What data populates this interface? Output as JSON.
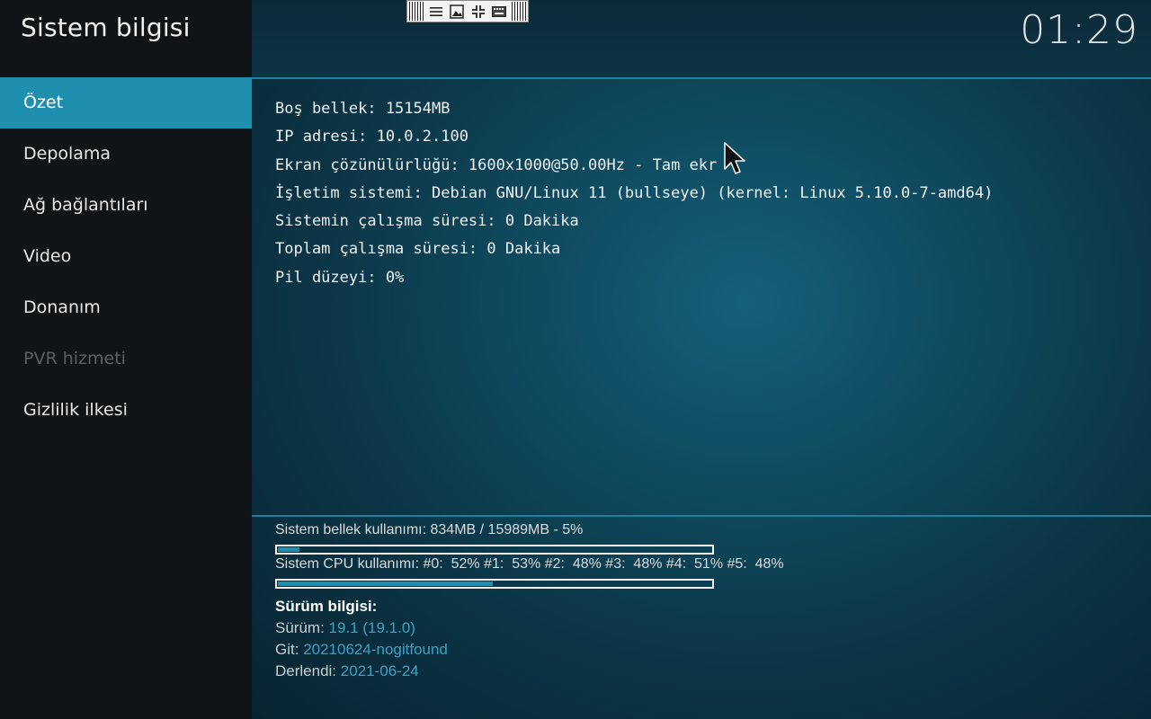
{
  "window_title": "Sistem bilgisi",
  "clock": "01:29",
  "sidebar": {
    "items": [
      {
        "label": "Özet",
        "state": "active"
      },
      {
        "label": "Depolama",
        "state": "normal"
      },
      {
        "label": "Ağ bağlantıları",
        "state": "normal"
      },
      {
        "label": "Video",
        "state": "normal"
      },
      {
        "label": "Donanım",
        "state": "normal"
      },
      {
        "label": "PVR hizmeti",
        "state": "disabled"
      },
      {
        "label": "Gizlilik ilkesi",
        "state": "normal"
      }
    ]
  },
  "toolbar": {
    "icons": [
      "menu-icon",
      "image-icon",
      "shrink-icon",
      "keyboard-icon"
    ]
  },
  "info_lines": [
    "Boş bellek: 15154MB",
    "IP adresi: 10.0.2.100",
    "Ekran çözünülürlüğü: 1600x1000@50.00Hz - Tam ekr",
    "İşletim sistemi: Debian GNU/Linux 11 (bullseye) (kernel: Linux 5.10.0-7-amd64)",
    "Sistemin çalışma süresi: 0 Dakika",
    "Toplam çalışma süresi: 0 Dakika",
    "Pil düzeyi: 0%"
  ],
  "memory": {
    "label": "Sistem bellek kullanımı: 834MB / 15989MB - 5%",
    "fraction": 0.05
  },
  "cpu": {
    "label": "Sistem CPU kullanımı: #0:  52% #1:  53% #2:  48% #3:  48% #4:  51% #5:  48%",
    "fraction": 0.5
  },
  "version": {
    "title": "Sürüm bilgisi:",
    "rows": [
      {
        "key": "Sürüm:",
        "value": "19.1 (19.1.0)"
      },
      {
        "key": "Git:",
        "value": "20210624-nogitfound"
      },
      {
        "key": "Derlendi:",
        "value": "2021-06-24"
      }
    ]
  },
  "colors": {
    "accent": "#1f8fb0",
    "version_value": "#3ba2c6",
    "disabled": "#5b5f62"
  }
}
